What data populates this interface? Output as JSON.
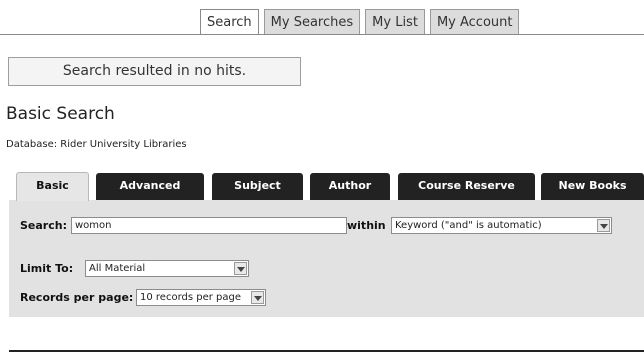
{
  "nav": {
    "tabs": [
      {
        "label": "Search"
      },
      {
        "label": "My Searches"
      },
      {
        "label": "My List"
      },
      {
        "label": "My Account"
      }
    ]
  },
  "message": "Search resulted in no hits.",
  "page": {
    "title": "Basic Search",
    "database": "Database: Rider University Libraries"
  },
  "search_tabs": [
    {
      "label": "Basic"
    },
    {
      "label": "Advanced"
    },
    {
      "label": "Subject"
    },
    {
      "label": "Author"
    },
    {
      "label": "Course Reserve"
    },
    {
      "label": "New Books"
    }
  ],
  "form": {
    "search_label": "Search:",
    "search_value": "womon",
    "within_label": "within",
    "within_value": "Keyword (\"and\" is automatic)",
    "limit_label": "Limit To:",
    "limit_value": "All Material",
    "records_label": "Records per page:",
    "records_value": "10 records per page"
  }
}
